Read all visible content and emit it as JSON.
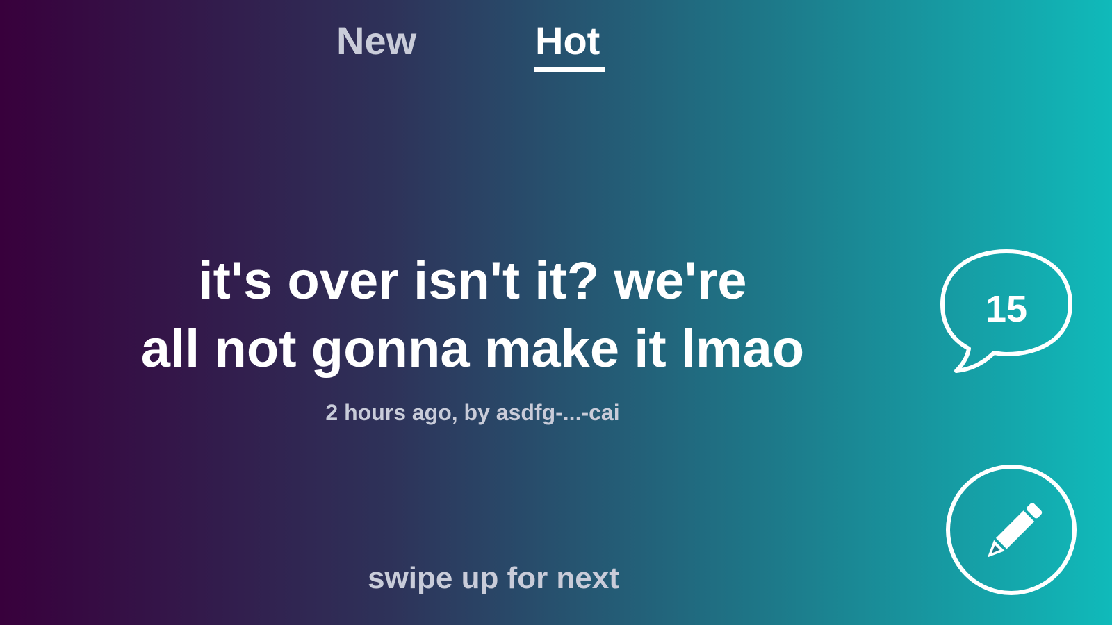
{
  "tabs": {
    "new_label": "New",
    "hot_label": "Hot",
    "active": "Hot"
  },
  "post": {
    "title_line1": "it's over isn't it? we're",
    "title_line2": "all not gonna make it lmao",
    "meta": "2 hours ago, by asdfg-...-cai",
    "comment_count": "15"
  },
  "footer": {
    "swipe_hint": "swipe up for next"
  },
  "icons": {
    "comment": "speech-bubble-icon",
    "edit": "pencil-icon"
  },
  "colors": {
    "gradient_start": "#38003c",
    "gradient_end": "#10baba",
    "text_primary": "#ffffff",
    "text_muted": "#c9ccd9"
  }
}
